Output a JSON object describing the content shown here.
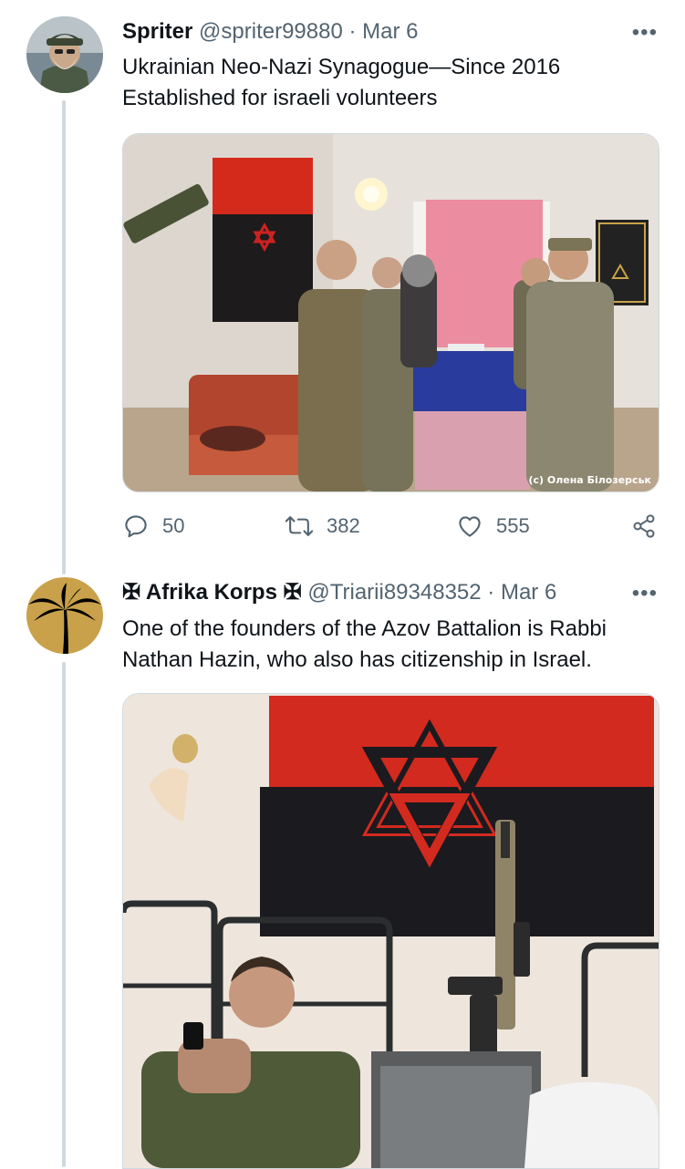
{
  "tweets": [
    {
      "display_name": "Spriter",
      "handle": "@spriter99880",
      "date": "· Mar 6",
      "more": "•••",
      "text_lines": [
        "Ukrainian Neo-Nazi Synagogue—Since 2016",
        "Established for israeli volunteers"
      ],
      "media_credit": "(c) Олена Білозерськ",
      "stats": {
        "replies": "50",
        "retweets": "382",
        "likes": "555"
      }
    },
    {
      "display_name": "✠ Afrika Korps ✠",
      "handle": "@Triarii89348352",
      "date": "· Mar 6",
      "more": "•••",
      "text_lines": [
        "One of the founders of the Azov Battalion is Rabbi",
        "Nathan Hazin, who also has citizenship in Israel."
      ]
    }
  ],
  "icons": {
    "reply": "reply-icon",
    "retweet": "retweet-icon",
    "like": "heart-icon",
    "share": "share-icon"
  },
  "colors": {
    "text": "#0f1419",
    "secondary": "#536471",
    "border": "#cfd9de"
  }
}
